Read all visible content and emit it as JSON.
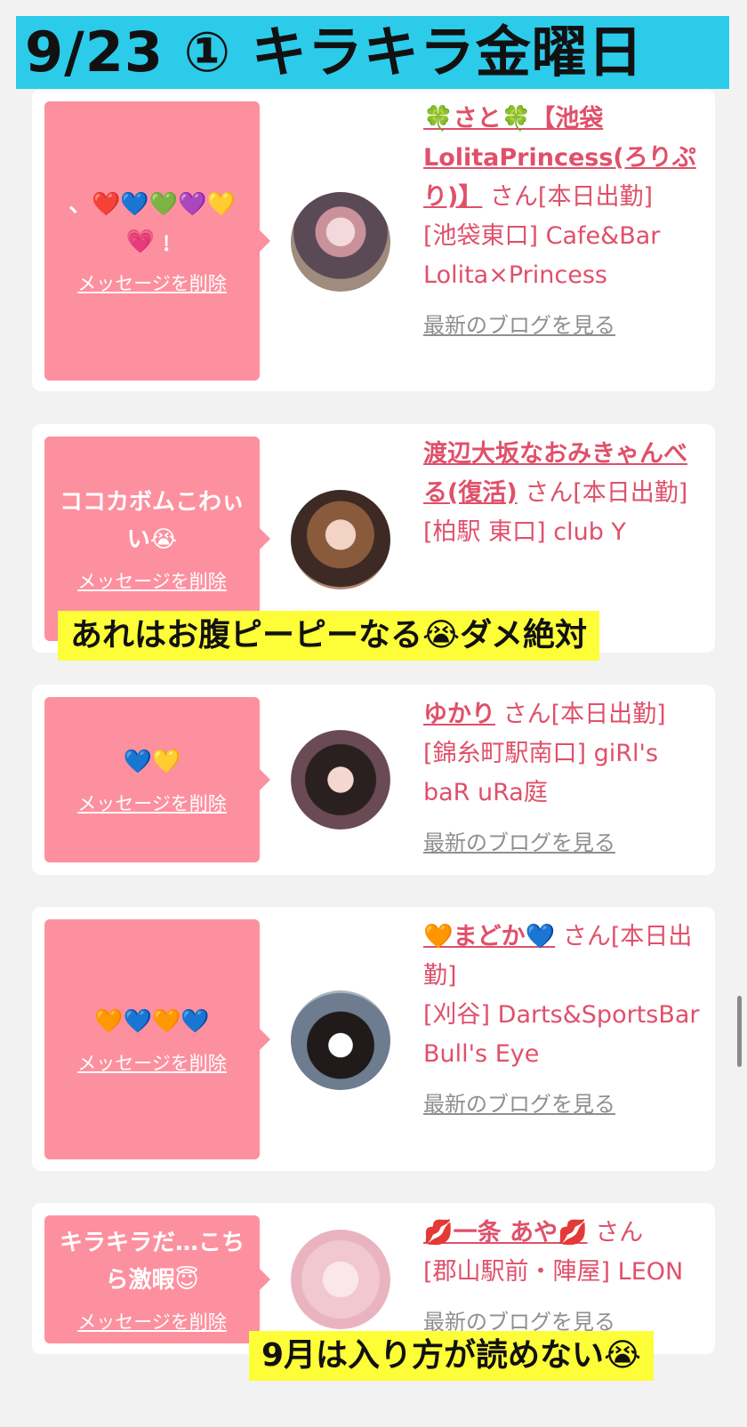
{
  "banner": {
    "title": "9/23 ① キラキラ金曜日"
  },
  "delete_label": "メッセージを削除",
  "cards": [
    {
      "message": "、❤️💙💚💜💛 💗﹗",
      "name": "🍀さと🍀【池袋LolitaPrincess(ろりぷり)】",
      "suffix": " さん[本日出勤]",
      "shop": "[池袋東口] Cafe&Bar Lolita×Princess",
      "blog": "最新のブログを見る"
    },
    {
      "message": "ココカボムこわぃい😭",
      "name": "渡辺大坂なおみきゃんべる(復活)",
      "suffix": " さん[本日出勤]",
      "shop": "[柏駅 東口] club Y",
      "blog": ""
    },
    {
      "message": "💙💛",
      "name": "ゆかり",
      "suffix": " さん[本日出勤]",
      "shop": "[錦糸町駅南口] giRl's baR uRa庭",
      "blog": "最新のブログを見る"
    },
    {
      "message": "🧡💙🧡💙",
      "name": "🧡まどか💙",
      "suffix": " さん[本日出勤]",
      "shop": "[刈谷] Darts&SportsBar Bull's Eye",
      "blog": "最新のブログを見る"
    },
    {
      "message": "キラキラだ…こちら激暇😇",
      "name": "💋一条 あや💋",
      "suffix": " さん",
      "shop": "[郡山駅前・陣屋] LEON",
      "blog": "最新のブログを見る"
    }
  ],
  "captions": {
    "top": "あれはお腹ピーピーなる😭ダメ絶対",
    "bottom": "9月は入り方が読めない😭"
  }
}
